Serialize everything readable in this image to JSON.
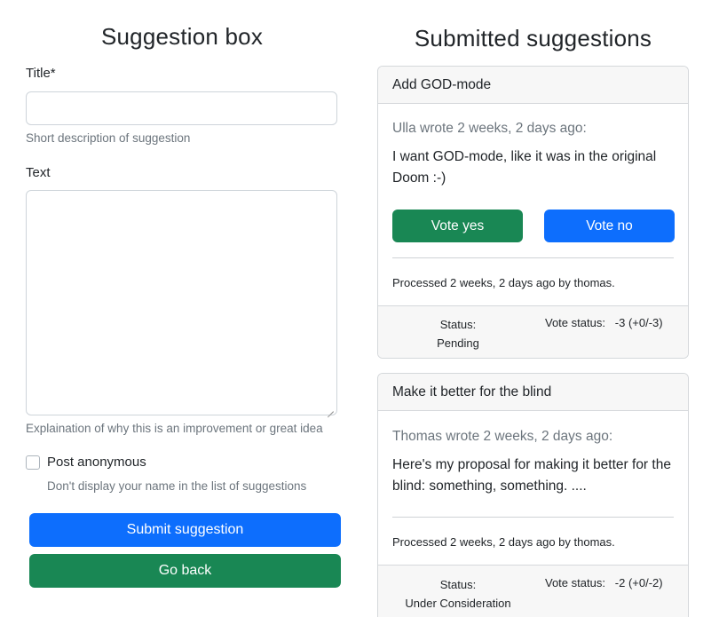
{
  "form": {
    "heading": "Suggestion box",
    "title_label": "Title*",
    "title_value": "",
    "title_help": "Short description of suggestion",
    "text_label": "Text",
    "text_value": "",
    "text_help": "Explaination of why this is an improvement or great idea",
    "anonymous_label": "Post anonymous",
    "anonymous_checked": false,
    "anonymous_help": "Don't display your name in the list of suggestions",
    "submit_label": "Submit suggestion",
    "back_label": "Go back"
  },
  "list": {
    "heading": "Submitted suggestions",
    "suggestions": [
      {
        "title": "Add GOD-mode",
        "author_line": "Ulla wrote 2 weeks, 2 days ago:",
        "text": "I want GOD-mode, like it was in the original Doom :-)",
        "vote_yes": "Vote yes",
        "vote_no": "Vote no",
        "processed": "Processed 2 weeks, 2 days ago by thomas.",
        "status_label": "Status:",
        "status_value": "Pending",
        "vote_status_label": "Vote status:",
        "vote_status_value": "-3 (+0/-3)"
      },
      {
        "title": "Make it better for the blind",
        "author_line": "Thomas wrote 2 weeks, 2 days ago:",
        "text": "Here's my proposal for making it better for the blind: something, something. ....",
        "processed": "Processed 2 weeks, 2 days ago by thomas.",
        "status_label": "Status:",
        "status_value": "Under Consideration",
        "vote_status_label": "Vote status:",
        "vote_status_value": "-2 (+0/-2)"
      }
    ]
  },
  "colors": {
    "primary": "#0d6efd",
    "success": "#198754",
    "muted": "#6c757d"
  }
}
